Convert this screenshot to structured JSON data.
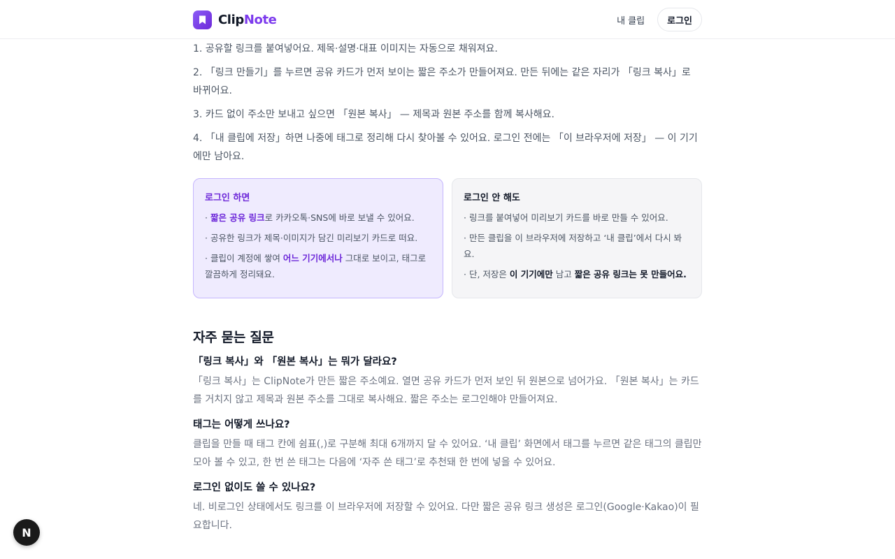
{
  "header": {
    "brand_part1": "Clip",
    "brand_part2": "Note",
    "nav_my_clips": "내 클립",
    "login_label": "로그인"
  },
  "steps": [
    "1. 공유할 링크를 붙여넣어요. 제목·설명·대표 이미지는 자동으로 채워져요.",
    "2. 「링크 만들기」를 누르면 공유 카드가 먼저 보이는 짧은 주소가 만들어져요. 만든 뒤에는 같은 자리가 「링크 복사」로 바뀌어요.",
    "3. 카드 없이 주소만 보내고 싶으면 「원본 복사」 — 제목과 원본 주소를 함께 복사해요.",
    "4. 「내 클립에 저장」하면 나중에 태그로 정리해 다시 찾아볼 수 있어요. 로그인 전에는 「이 브라우저에 저장」 — 이 기기에만 남아요."
  ],
  "card_login": {
    "title": "로그인 하면",
    "item1_strong": "짧은 공유 링크",
    "item1_rest": "로 카카오톡·SNS에 바로 보낼 수 있어요.",
    "item2": "· 공유한 링크가 제목·이미지가 담긴 미리보기 카드로 떠요.",
    "item3_pre": "· 클립이 계정에 쌓여 ",
    "item3_strong": "어느 기기에서나",
    "item3_post": " 그대로 보이고, 태그로 깔끔하게 정리돼요."
  },
  "card_nologin": {
    "title": "로그인 안 해도",
    "item1": "· 링크를 붙여넣어 미리보기 카드를 바로 만들 수 있어요.",
    "item2": "· 만든 클립을 이 브라우저에 저장하고 ‘내 클립’에서 다시 봐요.",
    "item3_pre": "· 단, 저장은 ",
    "item3_strong1": "이 기기에만",
    "item3_mid": " 남고 ",
    "item3_strong2": "짧은 공유 링크는 못 만들어요."
  },
  "faq": {
    "title": "자주 묻는 질문",
    "items": [
      {
        "q": "「링크 복사」와 「원본 복사」는 뭐가 달라요?",
        "a": "「링크 복사」는 ClipNote가 만든 짧은 주소예요. 열면 공유 카드가 먼저 보인 뒤 원본으로 넘어가요. 「원본 복사」는 카드를 거치지 않고 제목과 원본 주소를 그대로 복사해요. 짧은 주소는 로그인해야 만들어져요."
      },
      {
        "q": "태그는 어떻게 쓰나요?",
        "a": "클립을 만들 때 태그 칸에 쉼표(,)로 구분해 최대 6개까지 달 수 있어요. ‘내 클립’ 화면에서 태그를 누르면 같은 태그의 클립만 모아 볼 수 있고, 한 번 쓴 태그는 다음에 ‘자주 쓴 태그’로 추천돼 한 번에 넣을 수 있어요."
      },
      {
        "q": "로그인 없이도 쓸 수 있나요?",
        "a": "네. 비로그인 상태에서도 링크를 이 브라우저에 저장할 수 있어요. 다만 짧은 공유 링크 생성은 로그인(Google·Kakao)이 필요합니다."
      }
    ]
  },
  "dev_badge": {
    "letter": "N"
  },
  "colors": {
    "accent": "#7c3aed",
    "card_login_bg": "#efebfe",
    "card_nologin_bg": "#f5f5f7"
  }
}
